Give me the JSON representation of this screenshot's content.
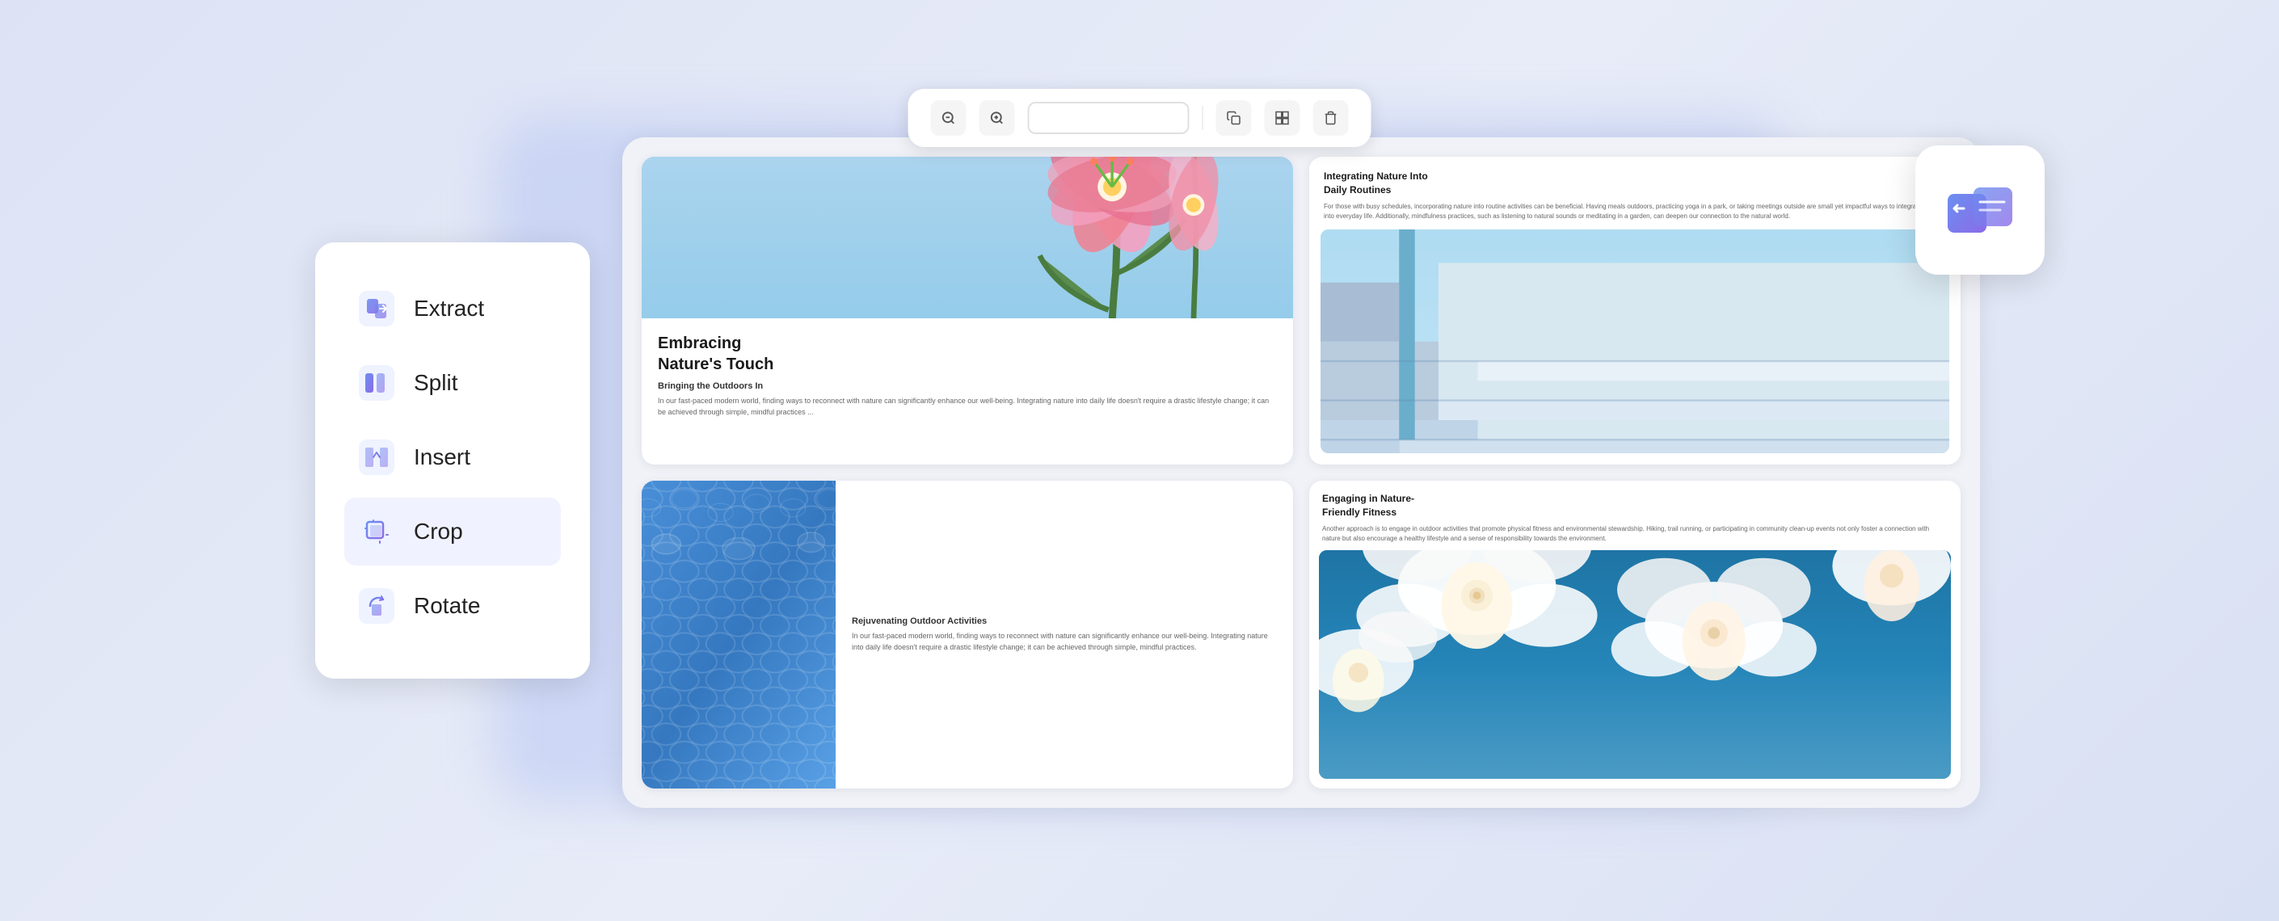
{
  "toolbar": {
    "zoom_out_label": "−",
    "zoom_in_label": "+",
    "input_placeholder": "",
    "copy_label": "⧉",
    "layout_label": "⊞",
    "delete_label": "🗑"
  },
  "sidebar": {
    "items": [
      {
        "id": "extract",
        "label": "Extract",
        "icon": "extract-icon"
      },
      {
        "id": "split",
        "label": "Split",
        "icon": "split-icon"
      },
      {
        "id": "insert",
        "label": "Insert",
        "icon": "insert-icon"
      },
      {
        "id": "crop",
        "label": "Crop",
        "icon": "crop-icon"
      },
      {
        "id": "rotate",
        "label": "Rotate",
        "icon": "rotate-icon"
      }
    ]
  },
  "pdf_pages": [
    {
      "id": "page1",
      "title": "Embracing\nNature's Touch",
      "subtitle": "Bringing the Outdoors In",
      "body": "In our fast-paced modern world, finding ways to reconnect with nature can significantly enhance our well-being. Integrating nature into daily life doesn't require a drastic lifestyle change; it can be achieved through simple, mindful practices ..."
    },
    {
      "id": "page2",
      "title": "Integrating Nature Into\nDaily Routines",
      "body": "For those with busy schedules, incorporating nature into routine activities can be beneficial. Having meals outdoors, practicing yoga in a park, or taking meetings outside are small yet impactful ways to integrate nature into everyday life. Additionally, mindfulness practices, such as listening to natural sounds or meditating in a garden, can deepen our connection to the natural world."
    },
    {
      "id": "page3",
      "subtitle": "Rejuvenating Outdoor Activities",
      "body": "In our fast-paced modern world, finding ways to reconnect with nature can significantly enhance our well-being. Integrating nature into daily life doesn't require a drastic lifestyle change; it can be achieved through simple, mindful practices."
    },
    {
      "id": "page4",
      "title": "Engaging in Nature-\nFriendly Fitness",
      "body": "Another approach is to engage in outdoor activities that promote physical fitness and environmental stewardship. Hiking, trail running, or participating in community clean-up events not only foster a connection with nature but also encourage a healthy lifestyle and a sense of responsibility towards the environment."
    }
  ],
  "colors": {
    "accent": "#5b7fde",
    "accent_gradient_start": "#6b8ff0",
    "accent_gradient_end": "#8b6be8",
    "sidebar_bg": "#ffffff",
    "page_bg": "#f0f2f8",
    "sky_blue": "#87ceeb",
    "ocean_blue": "#4a90d9"
  }
}
